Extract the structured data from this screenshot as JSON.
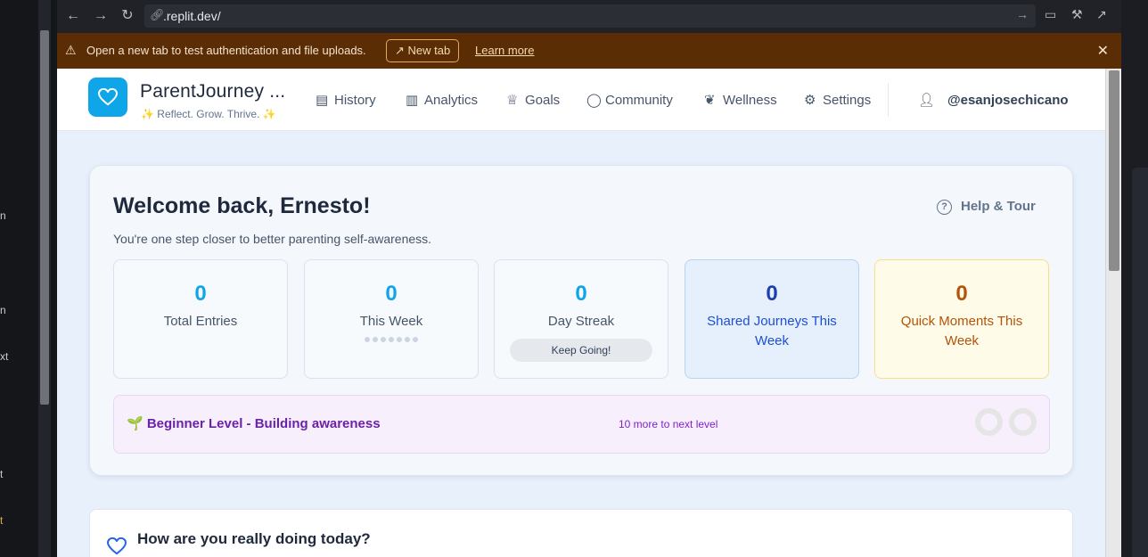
{
  "left_pane": {
    "fragments": [
      "n",
      "n",
      "xt",
      "t",
      "t"
    ]
  },
  "browser": {
    "url": ".replit.dev/",
    "icons": [
      "back-arrow-icon",
      "forward-arrow-icon",
      "reload-icon",
      "link-icon",
      "go-arrow-icon",
      "devices-icon",
      "wrench-icon",
      "open-external-icon"
    ]
  },
  "banner": {
    "message": "Open a new tab to test authentication and file uploads.",
    "new_tab_label": "New tab",
    "learn_more_label": "Learn more",
    "background": "#5a2d05"
  },
  "header": {
    "brand_title": "ParentJourney ...",
    "brand_subtitle": "✨ Reflect. Grow. Thrive. ✨",
    "nav": [
      {
        "label": "History",
        "icon": "archive-icon"
      },
      {
        "label": "Analytics",
        "icon": "bar-chart-icon"
      },
      {
        "label": "Goals",
        "icon": "trophy-icon"
      },
      {
        "label": "Community",
        "icon": "chat-bubble-icon"
      },
      {
        "label": "Wellness",
        "icon": "leaf-icon"
      },
      {
        "label": "Settings",
        "icon": "gear-icon"
      }
    ],
    "username": "@esanjosechicano",
    "accent": "#0ea5e9"
  },
  "welcome": {
    "title": "Welcome back, Ernesto!",
    "subtitle": "You're one step closer to better parenting self-awareness.",
    "help_label": "Help & Tour",
    "stats": [
      {
        "value": "0",
        "label": "Total Entries"
      },
      {
        "value": "0",
        "label": "This Week"
      },
      {
        "value": "0",
        "label": "Day Streak",
        "badge": "Keep Going!"
      },
      {
        "value": "0",
        "label": "Shared Journeys This Week"
      },
      {
        "value": "0",
        "label": "Quick Moments This Week"
      }
    ],
    "level": {
      "name": "🌱 Beginner Level - Building awareness",
      "next": "10 more to next level"
    }
  },
  "mood": {
    "title": "How are you really doing today?"
  }
}
